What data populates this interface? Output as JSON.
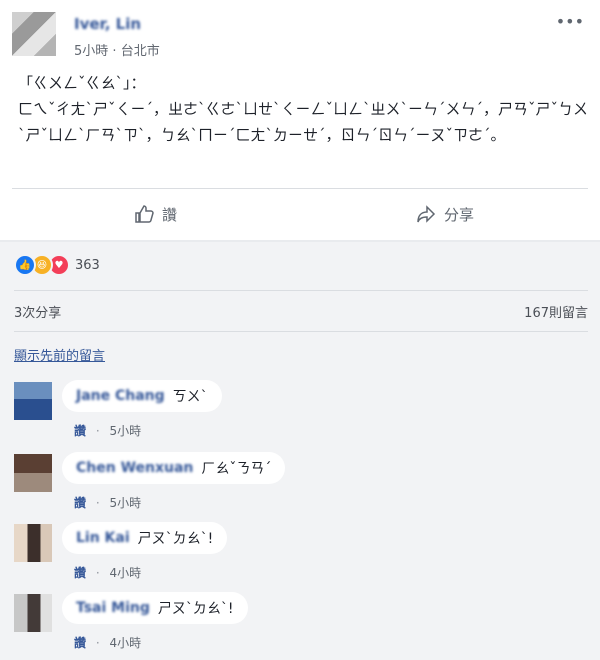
{
  "post": {
    "author": "Iver, Lin",
    "time": "5小時",
    "location": "台北市",
    "text": "「ㄍㄨㄥˇㄍㄠˋ」：\nㄈㄟˇㄔㄤˋㄕˇㄑㄧˊ，ㄓㄜˋㄍㄜˋㄩㄝˋㄑㄧㄥˇㄩㄥˋㄓㄨˋㄧㄣˊㄨㄣˊ，ㄕㄢˇㄕˇㄅㄨˋㄕˇㄩㄥˋㄏㄢˋㄗˋ，ㄅㄠˋㄇㄧˊㄈㄤˋㄉㄧㄝˊ，ㄖㄣˊㄖㄣˊㄧㄡˇㄗㄜˊ。",
    "like_label": "讚",
    "share_label": "分享"
  },
  "reactions": {
    "count": "363",
    "shares": "3次分享",
    "comments": "167則留言"
  },
  "prev_comments": "顯示先前的留言",
  "comments": [
    {
      "name": "Jane Chang",
      "text": "ㄎㄨˋ",
      "like": "讚",
      "time": "5小時"
    },
    {
      "name": "Chen Wenxuan",
      "text": "ㄏㄠˇㄋㄢˊ",
      "like": "讚",
      "time": "5小時"
    },
    {
      "name": "Lin Kai",
      "text": "ㄕㄡˋㄉㄠˋ!",
      "like": "讚",
      "time": "4小時"
    },
    {
      "name": "Tsai Ming",
      "text": "ㄕㄡˋㄉㄠˋ!",
      "like": "讚",
      "time": "4小時"
    }
  ]
}
